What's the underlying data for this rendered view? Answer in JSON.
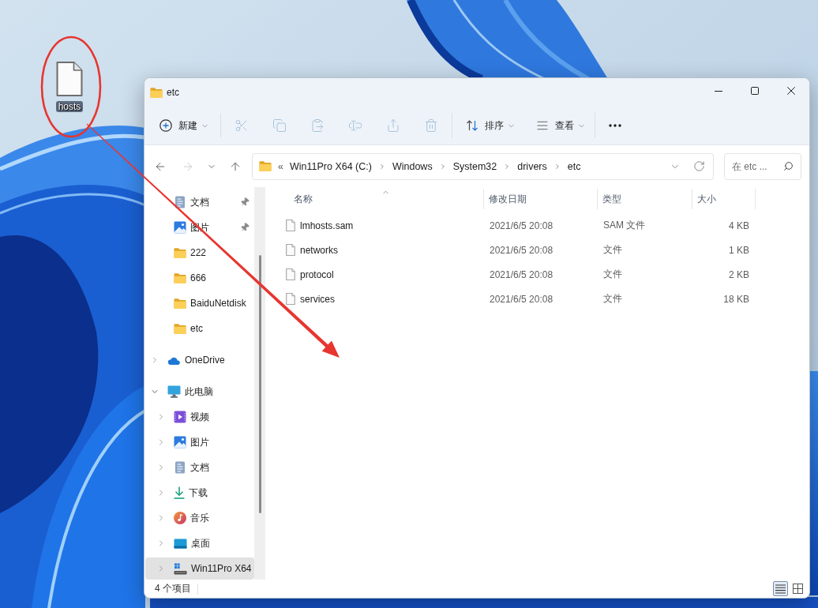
{
  "desktop": {
    "icons": [
      {
        "label": "hosts"
      }
    ]
  },
  "window": {
    "title": "etc"
  },
  "toolbar": {
    "groups": [
      [
        {
          "kind": "new",
          "label": "新建",
          "disabled": false
        }
      ],
      [
        {
          "kind": "cut",
          "disabled": true
        },
        {
          "kind": "copy",
          "disabled": true
        },
        {
          "kind": "paste",
          "disabled": true
        },
        {
          "kind": "rename",
          "disabled": true
        },
        {
          "kind": "share",
          "disabled": true
        },
        {
          "kind": "delete",
          "disabled": true
        }
      ],
      [
        {
          "kind": "sort",
          "label": "排序",
          "disabled": false
        },
        {
          "kind": "view",
          "label": "查看",
          "disabled": false
        }
      ],
      [
        {
          "kind": "more",
          "disabled": false
        }
      ]
    ]
  },
  "navigation": [
    {
      "kind": "back",
      "disabled": false
    },
    {
      "kind": "forward",
      "disabled": true
    },
    {
      "kind": "recent",
      "disabled": false
    },
    {
      "kind": "up",
      "disabled": false
    }
  ],
  "address_bar": {
    "overflow": "«",
    "crumbs": [
      "Win11Pro X64 (C:)",
      "Windows",
      "System32",
      "drivers",
      "etc"
    ]
  },
  "search": {
    "placeholder": "在 etc ..."
  },
  "sidebar": {
    "quick_access": [
      {
        "label": "文档",
        "kind": "documents",
        "pinned": true,
        "selected": false
      },
      {
        "label": "图片",
        "kind": "pictures",
        "pinned": true,
        "selected": false
      },
      {
        "label": "222",
        "kind": "folder",
        "pinned": false,
        "selected": false
      },
      {
        "label": "666",
        "kind": "folder",
        "pinned": false,
        "selected": false
      },
      {
        "label": "BaiduNetdisk",
        "kind": "folder",
        "pinned": false,
        "selected": false
      },
      {
        "label": "etc",
        "kind": "folder",
        "pinned": false,
        "selected": false
      }
    ],
    "tree": [
      {
        "label": "OneDrive",
        "kind": "cloud",
        "expanded": false,
        "selected": false
      },
      {
        "label": "此电脑",
        "kind": "computer",
        "expanded": true,
        "selected": false,
        "children": [
          {
            "label": "视频",
            "kind": "videos",
            "expanded": false,
            "selected": false
          },
          {
            "label": "图片",
            "kind": "pictures",
            "expanded": false,
            "selected": false
          },
          {
            "label": "文档",
            "kind": "documents",
            "expanded": false,
            "selected": false
          },
          {
            "label": "下载",
            "kind": "downloads",
            "expanded": false,
            "selected": false
          },
          {
            "label": "音乐",
            "kind": "music",
            "expanded": false,
            "selected": false
          },
          {
            "label": "桌面",
            "kind": "desktop",
            "expanded": false,
            "selected": false
          },
          {
            "label": "Win11Pro X64",
            "kind": "drive",
            "expanded": false,
            "selected": true
          }
        ]
      }
    ]
  },
  "file_list": {
    "columns": [
      {
        "label": "名称",
        "sorted": true
      },
      {
        "label": "修改日期",
        "sorted": false
      },
      {
        "label": "类型",
        "sorted": false
      },
      {
        "label": "大小",
        "sorted": false
      }
    ],
    "rows": [
      {
        "name": "lmhosts.sam",
        "modified": "2021/6/5 20:08",
        "type": "SAM 文件",
        "size": "4 KB",
        "selected": false
      },
      {
        "name": "networks",
        "modified": "2021/6/5 20:08",
        "type": "文件",
        "size": "1 KB",
        "selected": false
      },
      {
        "name": "protocol",
        "modified": "2021/6/5 20:08",
        "type": "文件",
        "size": "2 KB",
        "selected": false
      },
      {
        "name": "services",
        "modified": "2021/6/5 20:08",
        "type": "文件",
        "size": "18 KB",
        "selected": false
      }
    ]
  },
  "status_bar": {
    "item_count": "4 个项目",
    "views": [
      {
        "kind": "details",
        "selected": true
      },
      {
        "kind": "tiles",
        "selected": false
      }
    ]
  },
  "annotations": [
    {
      "kind": "ellipse"
    },
    {
      "kind": "arrow"
    }
  ]
}
